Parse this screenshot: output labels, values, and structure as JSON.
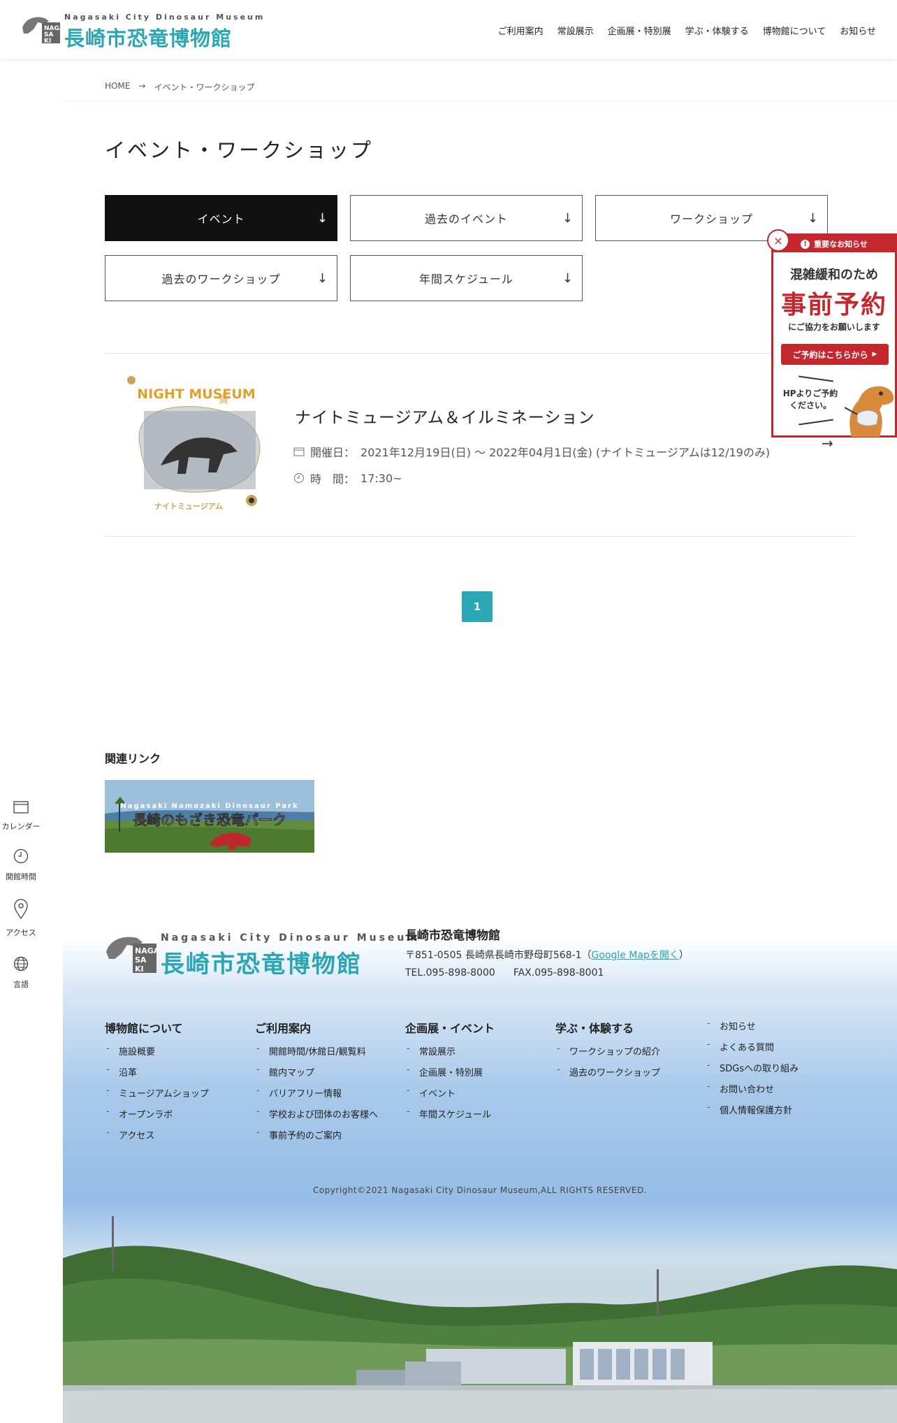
{
  "header": {
    "logo_en": "Nagasaki City Dinosaur Museum",
    "logo_jp": "長崎市恐竜博物館",
    "logo_badge": "NAGASAKI",
    "nav": [
      "ご利用案内",
      "常設展示",
      "企画展・特別展",
      "学ぶ・体験する",
      "博物館について",
      "お知らせ"
    ]
  },
  "breadcrumb": {
    "home": "HOME",
    "sep": "→",
    "current": "イベント・ワークショップ"
  },
  "page_title": "イベント・ワークショップ",
  "tabs": [
    {
      "label": "イベント",
      "active": true
    },
    {
      "label": "過去のイベント"
    },
    {
      "label": "ワークショップ"
    },
    {
      "label": "過去のワークショップ"
    },
    {
      "label": "年間スケジュール"
    }
  ],
  "tab_arrow": "↓",
  "event": {
    "thumb_title": "NIGHT MUSEUM",
    "thumb_sub": "ナイトミュージアム",
    "title": "ナイトミュージアム＆イルミネーション",
    "date_label": "開催日：",
    "date_value": "2021年12月19日(日) 〜 2022年04月1日(金) (ナイトミュージアムは12/19のみ)",
    "time_label": "時　間：",
    "time_value": "17:30~",
    "arrow": "→"
  },
  "pagination": {
    "current": "1"
  },
  "related": {
    "title": "関連リンク",
    "banner_en": "Nagasaki Nomozaki Dinosaur Park",
    "banner_jp": "長崎のもざき恐竜パーク"
  },
  "sidebar": [
    {
      "label": "カレンダー",
      "icon": "calendar-icon"
    },
    {
      "label": "開館時間",
      "icon": "clock-icon"
    },
    {
      "label": "アクセス",
      "icon": "map-pin-icon"
    },
    {
      "label": "言語",
      "icon": "globe-icon"
    }
  ],
  "notice": {
    "head": "重要なお知らせ",
    "line1": "混雑緩和のため",
    "line2": "事前予約",
    "line3": "にご協力をお願いします",
    "button": "ご予約はこちらから",
    "note": "HPよりご予約ください。",
    "close": "×"
  },
  "footer": {
    "logo_en": "Nagasaki City Dinosaur Museum",
    "logo_jp": "長崎市恐竜博物館",
    "name": "長崎市恐竜博物館",
    "address_prefix": "〒851-0505 長崎県長崎市野母町568-1（",
    "gmap_label": "Google Mapを開く",
    "address_suffix": "）",
    "tel": "TEL.095-898-8000",
    "fax": "FAX.095-898-8001",
    "columns": [
      {
        "title": "博物館について",
        "items": [
          "施設概要",
          "沿革",
          "ミュージアムショップ",
          "オープンラボ",
          "アクセス"
        ]
      },
      {
        "title": "ご利用案内",
        "items": [
          "開館時間/休館日/観覧料",
          "館内マップ",
          "バリアフリー情報",
          "学校および団体のお客様へ",
          "事前予約のご案内"
        ]
      },
      {
        "title": "企画展・イベント",
        "items": [
          "常設展示",
          "企画展・特別展",
          "イベント",
          "年間スケジュール"
        ]
      },
      {
        "title": "学ぶ・体験する",
        "items": [
          "ワークショップの紹介",
          "過去のワークショップ"
        ]
      },
      {
        "title": "",
        "items": [
          "お知らせ",
          "よくある質問",
          "SDGsへの取り組み",
          "お問い合わせ",
          "個人情報保護方針"
        ]
      }
    ],
    "copyright": "Copyright©2021 Nagasaki City Dinosaur Museum,ALL RIGHTS RESERVED."
  },
  "colors": {
    "accent": "#2aa6b5",
    "notice_red": "#c4272d",
    "active_tab": "#111111"
  }
}
